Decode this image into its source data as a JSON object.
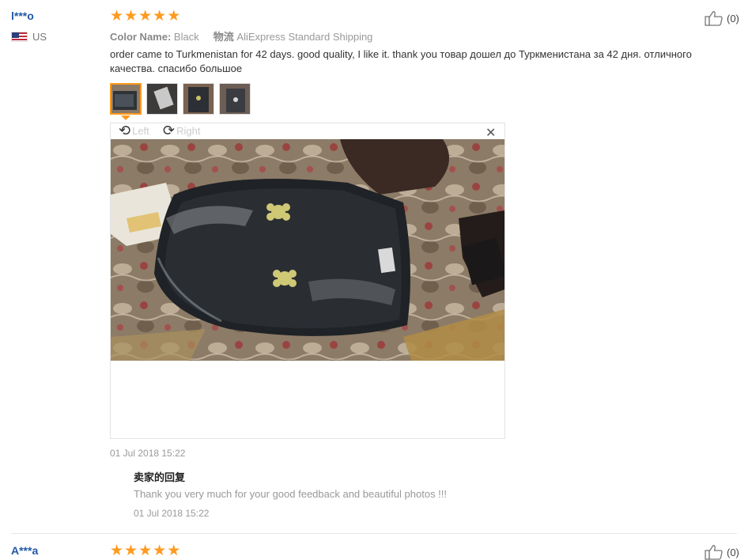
{
  "reviews": [
    {
      "user": "l***o",
      "country": "US",
      "rating": 5,
      "color_key": "Color Name:",
      "color_value": "Black",
      "shipping_key": "物流",
      "shipping_value": "AliExpress Standard Shipping",
      "text": "order came to Turkmenistan for 42 days. good quality, I like it. thank you товар дошел до Туркменистана за 42 дня. отличного качества. спасибо большое",
      "likes": "(0)",
      "photo_count": 4,
      "viewer": {
        "rotate_left_label": "Left",
        "rotate_right_label": "Right",
        "close_icon": "close-icon"
      },
      "date": "01 Jul 2018 15:22",
      "seller_reply": {
        "title": "卖家的回复",
        "text": "Thank you very much for your good feedback and beautiful photos !!!",
        "date": "01 Jul 2018 15:22"
      }
    },
    {
      "user": "A***a",
      "rating": 5,
      "likes": "(0)"
    }
  ],
  "colors": {
    "accent_star": "#ff9a1e",
    "username": "#2058a6"
  }
}
